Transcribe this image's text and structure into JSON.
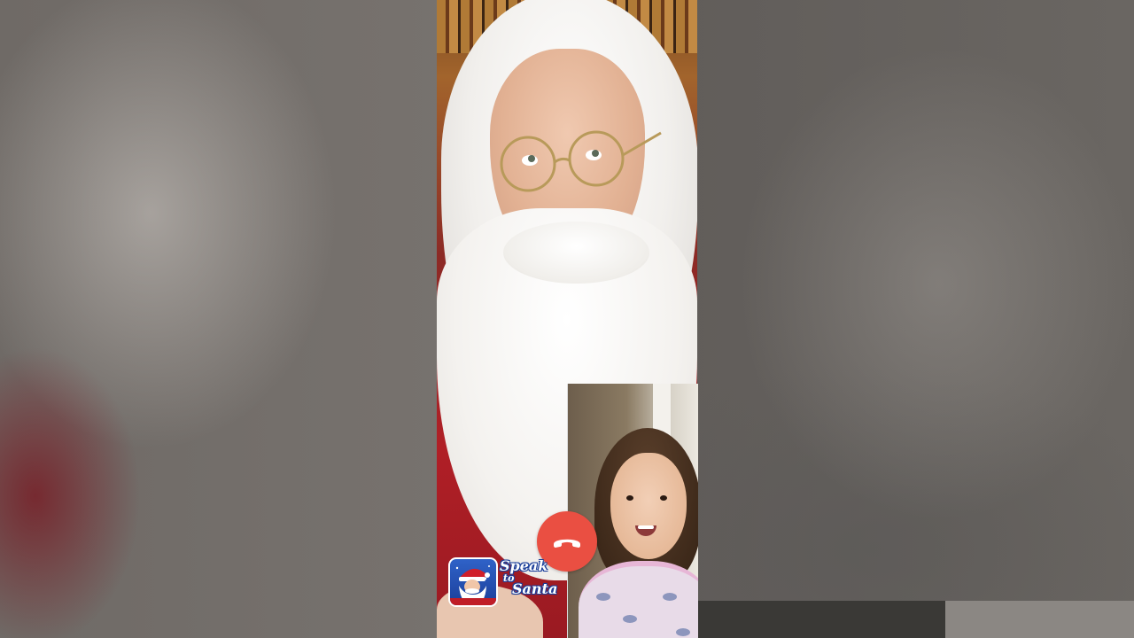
{
  "call": {
    "end_call_icon": "phone-hangup-icon",
    "end_call_color": "#ea4f42"
  },
  "app_logo": {
    "icon": "santa-icon",
    "line1": "Speak",
    "line2": "to",
    "line3": "Santa",
    "accent": "#1c3f9a"
  }
}
